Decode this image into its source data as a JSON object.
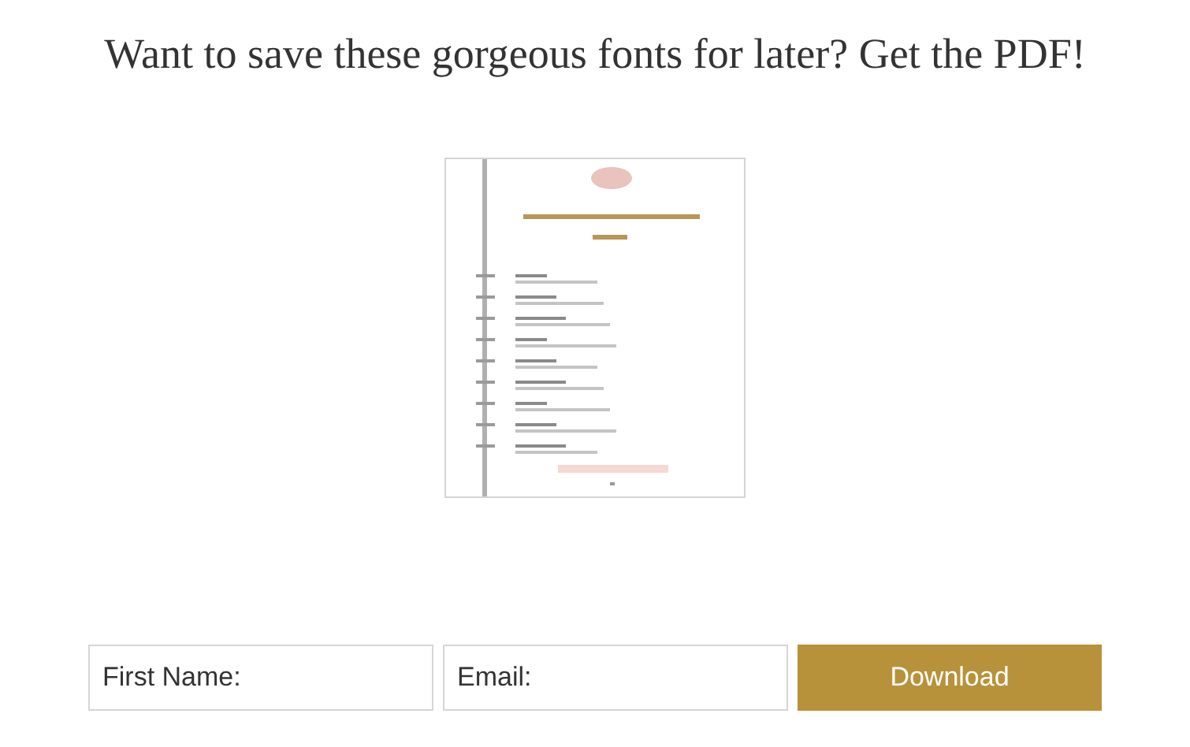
{
  "heading": "Want to save these gorgeous fonts for later? Get the PDF!",
  "form": {
    "fields": [
      {
        "placeholder": "First Name:"
      },
      {
        "placeholder": "Email:"
      }
    ],
    "button": "Download"
  }
}
